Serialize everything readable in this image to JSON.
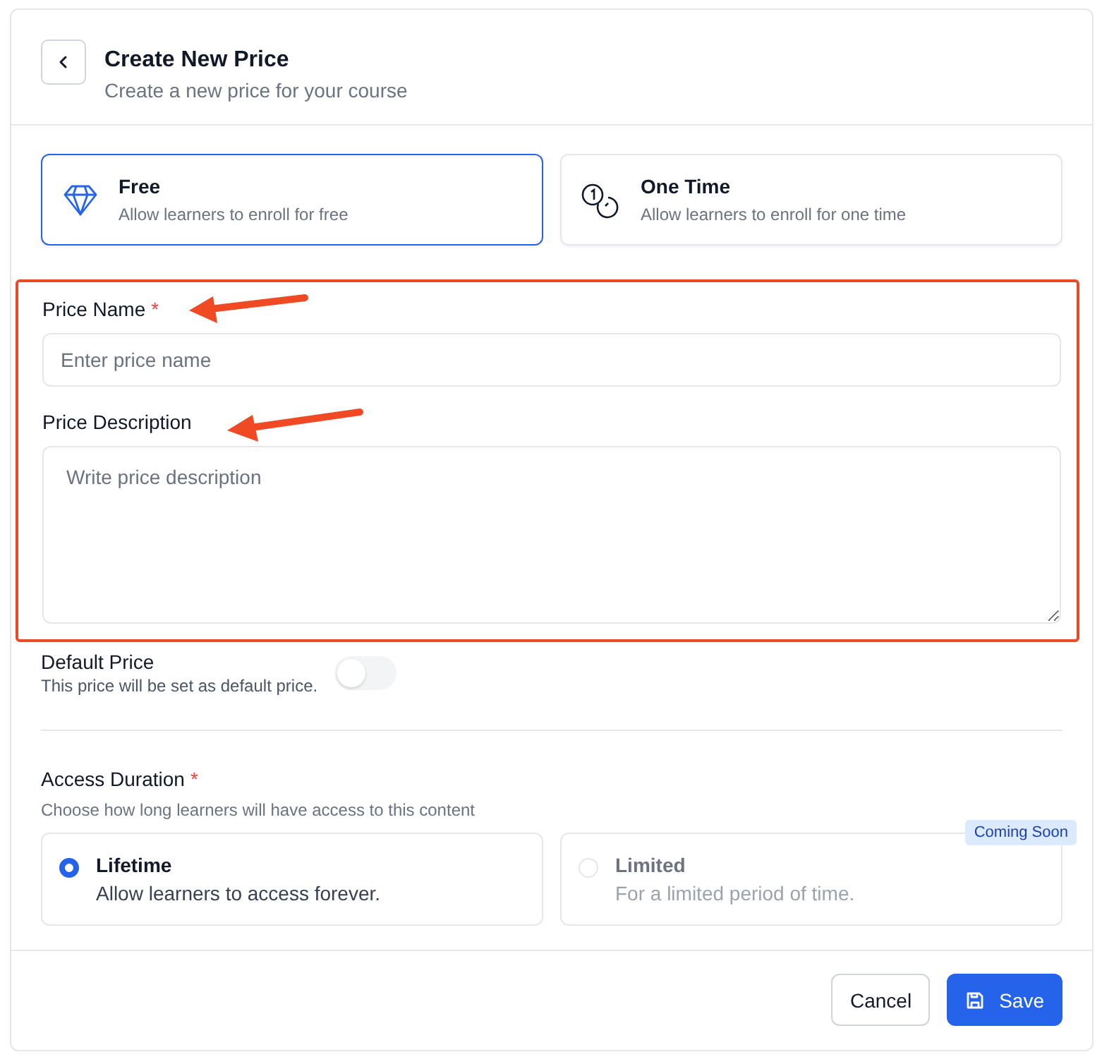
{
  "header": {
    "title": "Create New Price",
    "subtitle": "Create a new price for your course"
  },
  "price_types": [
    {
      "kind": "diamond",
      "title": "Free",
      "description": "Allow learners to enroll for free",
      "selected": true
    },
    {
      "kind": "coins",
      "title": "One Time",
      "description": "Allow learners to enroll for one time",
      "selected": false
    }
  ],
  "annotation": {
    "kind": "highlight"
  },
  "fields": [
    {
      "kind": "input",
      "label": "Price Name",
      "required_mark": "*",
      "placeholder": "Enter price name",
      "arrow": true
    },
    {
      "kind": "textarea",
      "label": "Price Description",
      "placeholder": "Write price description",
      "arrow": true
    }
  ],
  "default_price": {
    "label": "Default Price",
    "hint": "This price will be set as default price.",
    "on": false
  },
  "access_duration": {
    "label": "Access Duration",
    "required_mark": "*",
    "hint": "Choose how long learners will have access to this content",
    "options": [
      {
        "title": "Lifetime",
        "description": "Allow learners to access forever.",
        "selected": true,
        "disabled": false
      },
      {
        "title": "Limited",
        "description": "For a limited period of time.",
        "selected": false,
        "disabled": true,
        "badge": "Coming Soon"
      }
    ]
  },
  "buttons": [
    {
      "kind": "secondary",
      "label": "Cancel"
    },
    {
      "kind": "primary",
      "label": "Save"
    }
  ]
}
